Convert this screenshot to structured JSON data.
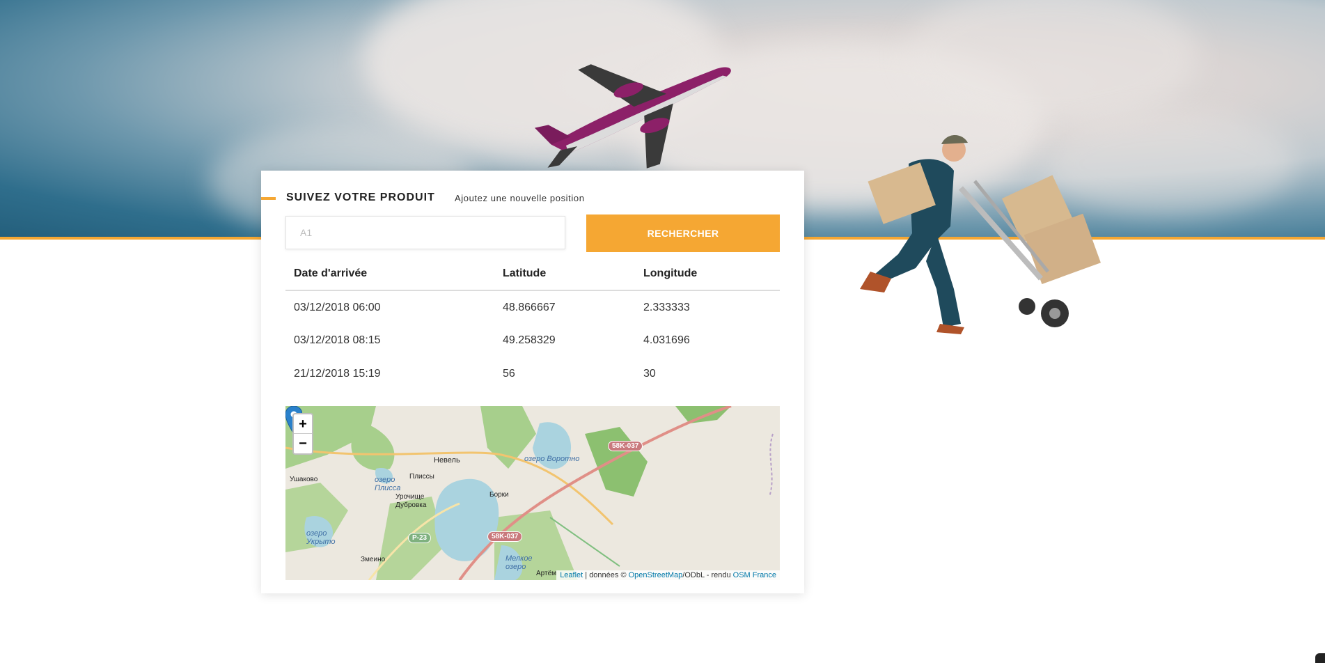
{
  "panel": {
    "title": "SUIVEZ VOTRE PRODUIT",
    "subtitle": "Ajoutez une nouvelle position"
  },
  "search": {
    "placeholder": "A1",
    "value": "",
    "button_label": "RECHERCHER"
  },
  "table": {
    "headers": [
      "Date d'arrivée",
      "Latitude",
      "Longitude"
    ],
    "rows": [
      [
        "03/12/2018 06:00",
        "48.866667",
        "2.333333"
      ],
      [
        "03/12/2018 08:15",
        "49.258329",
        "4.031696"
      ],
      [
        "21/12/2018 15:19",
        "56",
        "30"
      ]
    ]
  },
  "map": {
    "zoom_in": "+",
    "zoom_out": "−",
    "labels": [
      "Невель",
      "Плиссы",
      "Ушаково",
      "озеро Плисса",
      "Урочище Дубровка",
      "Борки",
      "озеро Воротно",
      "озеро Укрыто",
      "Змеино",
      "Мелкое озеро",
      "Артём"
    ],
    "road_badges": [
      "58K-037",
      "58K-037",
      "P-23"
    ],
    "attribution": {
      "leaflet": "Leaflet",
      "sep1": " | données © ",
      "osm": "OpenStreetMap",
      "sep2": "/ODbL - rendu ",
      "osm_france": "OSM France"
    }
  },
  "colors": {
    "accent": "#f5a733",
    "link": "#0078a8"
  },
  "icons": {
    "marker": "map-marker-icon",
    "plane": "airplane-image",
    "courier": "delivery-man-image"
  }
}
